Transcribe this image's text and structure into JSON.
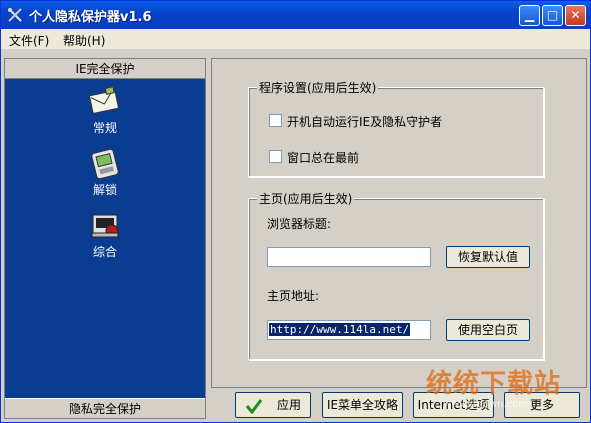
{
  "window": {
    "title": "个人隐私保护器v1.6"
  },
  "menu": {
    "file": "文件(F)",
    "help": "帮助(H)"
  },
  "sidebar": {
    "header": "IE完全保护",
    "items": [
      {
        "label": "常规",
        "icon": "envelope-icon"
      },
      {
        "label": "解锁",
        "icon": "pda-icon"
      },
      {
        "label": "综合",
        "icon": "computer-stack-icon"
      }
    ],
    "footer": "隐私完全保护"
  },
  "program_settings": {
    "title": "程序设置(应用后生效)",
    "autorun_label": "开机自动运行IE及隐私守护者",
    "topmost_label": "窗口总在最前"
  },
  "homepage": {
    "title": "主页(应用后生效)",
    "browser_title_label": "浏览器标题:",
    "browser_title_value": "",
    "restore_default_button": "恢复默认值",
    "address_label": "主页地址:",
    "address_value": "http://www.114la.net/",
    "use_blank_button": "使用空白页"
  },
  "bottom_buttons": {
    "apply": "应用",
    "ie_menu": "IE菜单全攻略",
    "internet_options": "Internet选项",
    "more": "更多"
  },
  "watermark": {
    "text": "统统下载站",
    "url": "www.itdown.com"
  }
}
